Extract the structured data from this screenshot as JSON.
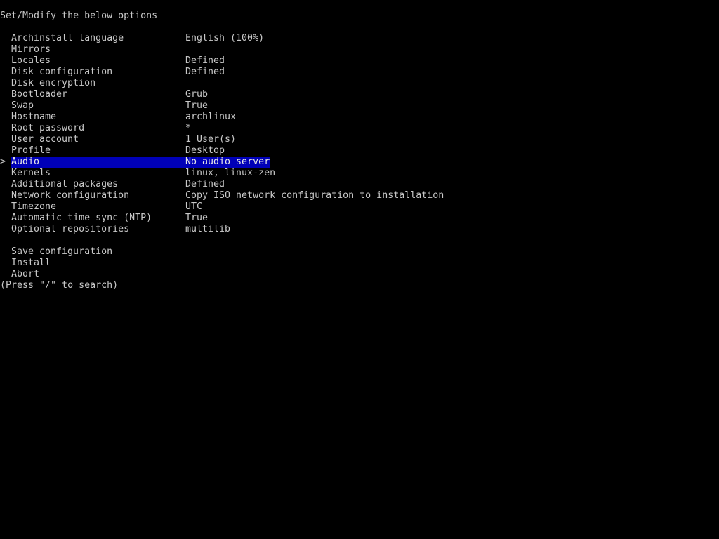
{
  "header": "Set/Modify the below options",
  "menu_items": [
    {
      "label": "Archinstall language",
      "value": "English (100%)"
    },
    {
      "label": "Mirrors",
      "value": ""
    },
    {
      "label": "Locales",
      "value": "Defined"
    },
    {
      "label": "Disk configuration",
      "value": "Defined"
    },
    {
      "label": "Disk encryption",
      "value": ""
    },
    {
      "label": "Bootloader",
      "value": "Grub"
    },
    {
      "label": "Swap",
      "value": "True"
    },
    {
      "label": "Hostname",
      "value": "archlinux"
    },
    {
      "label": "Root password",
      "value": "*"
    },
    {
      "label": "User account",
      "value": "1 User(s)"
    },
    {
      "label": "Profile",
      "value": "Desktop"
    },
    {
      "label": "Audio",
      "value": "No audio server"
    },
    {
      "label": "Kernels",
      "value": "linux, linux-zen"
    },
    {
      "label": "Additional packages",
      "value": "Defined"
    },
    {
      "label": "Network configuration",
      "value": "Copy ISO network configuration to installation"
    },
    {
      "label": "Timezone",
      "value": "UTC"
    },
    {
      "label": "Automatic time sync (NTP)",
      "value": "True"
    },
    {
      "label": "Optional repositories",
      "value": "multilib"
    }
  ],
  "actions": [
    {
      "label": "Save configuration"
    },
    {
      "label": "Install"
    },
    {
      "label": "Abort"
    }
  ],
  "cursor_symbol": ">",
  "selected_index": 11,
  "footer": "(Press \"/\" to search)",
  "colors": {
    "background": "#000000",
    "text": "#c8c8c8",
    "highlight": "#0000b8",
    "cursor": "#c8c8c8"
  }
}
